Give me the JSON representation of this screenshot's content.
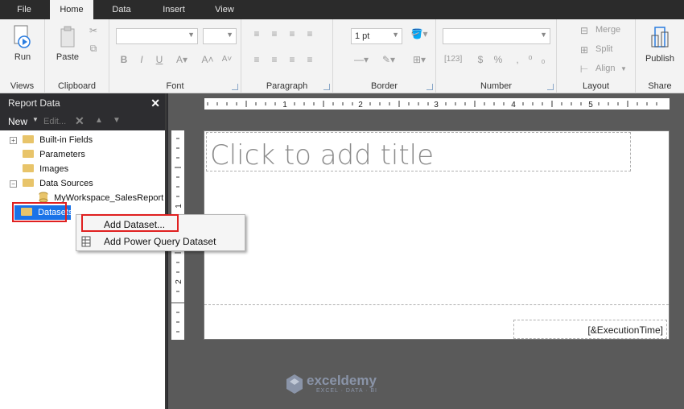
{
  "tabs": [
    {
      "label": "File",
      "active": false
    },
    {
      "label": "Home",
      "active": true
    },
    {
      "label": "Data",
      "active": false
    },
    {
      "label": "Insert",
      "active": false
    },
    {
      "label": "View",
      "active": false
    }
  ],
  "ribbon": {
    "views": {
      "label": "Views",
      "run_label": "Run"
    },
    "clipboard": {
      "label": "Clipboard",
      "paste_label": "Paste"
    },
    "font": {
      "label": "Font"
    },
    "paragraph": {
      "label": "Paragraph"
    },
    "border": {
      "label": "Border",
      "width_value": "1 pt"
    },
    "number": {
      "label": "Number"
    },
    "layout": {
      "label": "Layout",
      "merge_label": "Merge",
      "split_label": "Split",
      "align_label": "Align"
    },
    "share": {
      "label": "Share",
      "publish_label": "Publish"
    }
  },
  "panel": {
    "title": "Report Data",
    "new_label": "New",
    "edit_label": "Edit...",
    "tree": [
      {
        "label": "Built-in Fields",
        "expander": "+"
      },
      {
        "label": "Parameters",
        "expander": ""
      },
      {
        "label": "Images",
        "expander": ""
      },
      {
        "label": "Data Sources",
        "expander": "-"
      },
      {
        "label": "MyWorkspace_SalesReport",
        "expander": ""
      },
      {
        "label": "Datasets",
        "expander": "",
        "selected": true
      }
    ]
  },
  "context_menu": {
    "items": [
      {
        "label": "Add Dataset...",
        "icon": ""
      },
      {
        "label": "Add Power Query Dataset",
        "icon": "power-query-icon"
      }
    ]
  },
  "report": {
    "title_placeholder": "Click to add title",
    "footer_expression": "[&ExecutionTime]"
  },
  "ruler": {
    "h_numbers": [
      "1",
      "2",
      "3",
      "4",
      "5"
    ],
    "v_numbers": [
      "1",
      "2"
    ]
  },
  "watermark": {
    "brand": "exceldemy",
    "tagline": "EXCEL · DATA · BI"
  },
  "colors": {
    "selection": "#1a73e8",
    "highlight": "#e02020",
    "folder": "#e8c46a"
  }
}
